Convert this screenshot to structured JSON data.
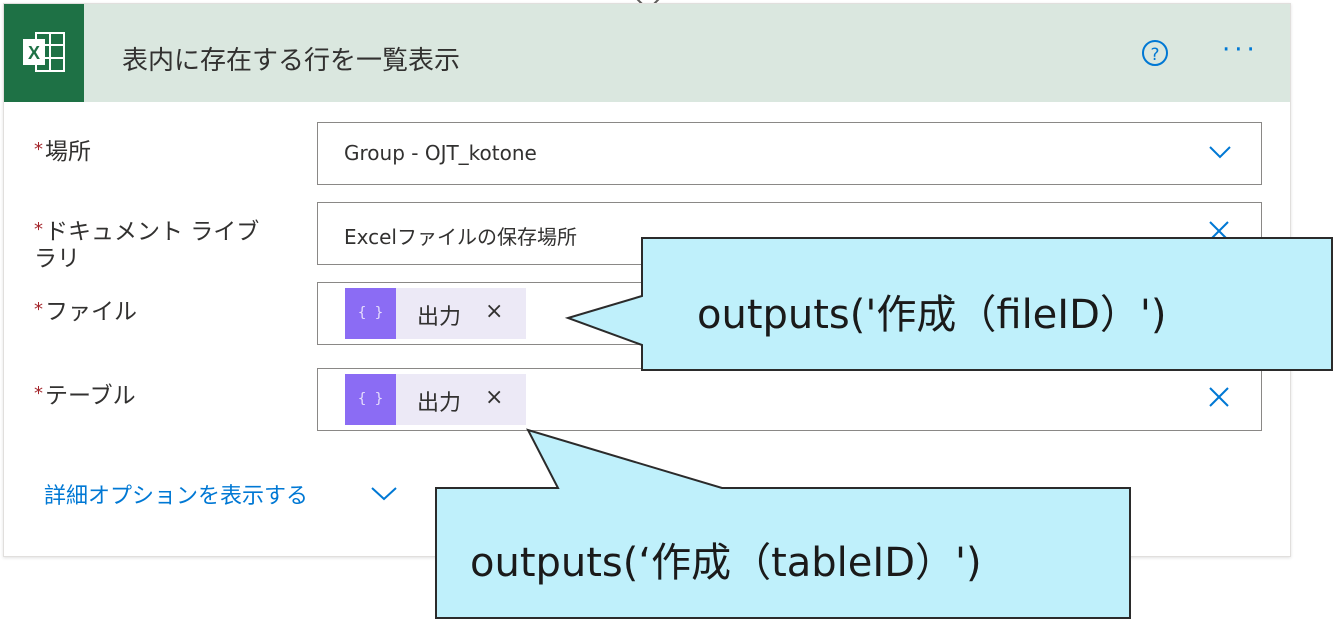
{
  "header": {
    "title": "表内に存在する行を一覧表示",
    "help_label": "?",
    "more_label": "···",
    "app_icon": "excel-icon",
    "app_icon_letter": "X",
    "colors": {
      "tile": "#1e7145",
      "header_bg": "#dae7df",
      "accent": "#0078d4"
    }
  },
  "form": {
    "location": {
      "required": "*",
      "label": "場所",
      "value": "Group - OJT_kotone"
    },
    "library": {
      "required": "*",
      "label_line1": "ドキュメント ライブ",
      "label_line2": "ラリ",
      "value": "Excelファイルの保存場所"
    },
    "file": {
      "required": "*",
      "label": "ファイル",
      "token": "出力",
      "token_remove": "×",
      "token_icon": "{ }"
    },
    "table": {
      "required": "*",
      "label": "テーブル",
      "token": "出力",
      "token_remove": "×",
      "token_icon": "{ }"
    },
    "advanced_link": "詳細オプションを表示する"
  },
  "callouts": {
    "file_id": "outputs('作成（fileID）')",
    "table_id": "outputs(‘作成（tableID）')",
    "fill": "#bff0fb"
  }
}
